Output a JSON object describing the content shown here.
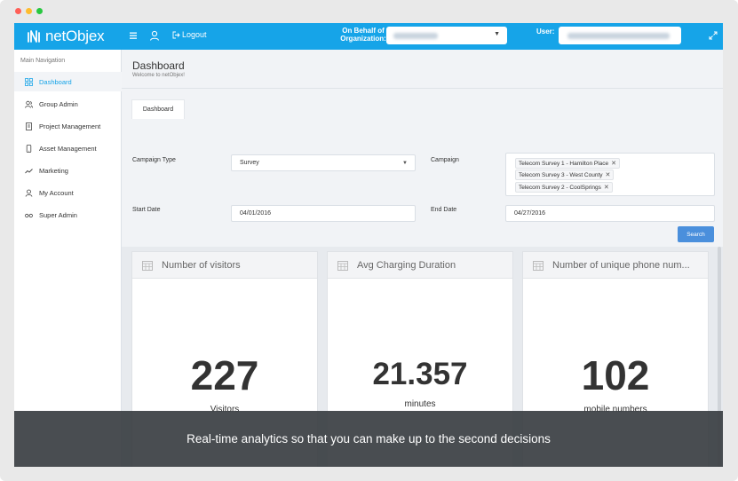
{
  "brand": {
    "name": "netObjex",
    "color": "#16a4e8",
    "accent_button": "#4a8fdc"
  },
  "window": {
    "dots": [
      {
        "name": "close",
        "color": "#ff5f57"
      },
      {
        "name": "minimize",
        "color": "#febc2e"
      },
      {
        "name": "maximize",
        "color": "#28c840"
      }
    ]
  },
  "topbar": {
    "logout_label": "Logout",
    "behalf_label": "On Behalf of Organization:",
    "user_label": "User:"
  },
  "sidebar": {
    "title": "Main Navigation",
    "items": [
      {
        "label": "Dashboard",
        "icon": "dashboard-icon",
        "active": true
      },
      {
        "label": "Group Admin",
        "icon": "group-icon",
        "active": false
      },
      {
        "label": "Project Management",
        "icon": "project-icon",
        "active": false
      },
      {
        "label": "Asset Management",
        "icon": "phone-icon",
        "active": false
      },
      {
        "label": "Marketing",
        "icon": "trend-icon",
        "active": false
      },
      {
        "label": "My Account",
        "icon": "account-icon",
        "active": false
      },
      {
        "label": "Super Admin",
        "icon": "glasses-icon",
        "active": false
      }
    ]
  },
  "page": {
    "title": "Dashboard",
    "subtitle": "Welcome to netObjex!",
    "tab_label": "Dashboard"
  },
  "form": {
    "campaign_type_label": "Campaign Type",
    "campaign_type_value": "Survey",
    "campaign_label": "Campaign",
    "campaigns": [
      "Telecom Survey 1 - Hamilton Place",
      "Telecom Survey 3 - West County",
      "Telecom Survey 2 - CoolSprings"
    ],
    "start_date_label": "Start Date",
    "start_date_value": "04/01/2016",
    "end_date_label": "End Date",
    "end_date_value": "04/27/2016",
    "search_label": "Search"
  },
  "cards": [
    {
      "title": "Number of visitors",
      "value": "227",
      "unit": "Visitors"
    },
    {
      "title": "Avg Charging Duration",
      "value": "21.357",
      "unit": "minutes"
    },
    {
      "title": "Number of unique phone num...",
      "value": "102",
      "unit": "mobile numbers"
    }
  ],
  "banner": {
    "text": "Real-time analytics so that you can make up to the second decisions"
  }
}
